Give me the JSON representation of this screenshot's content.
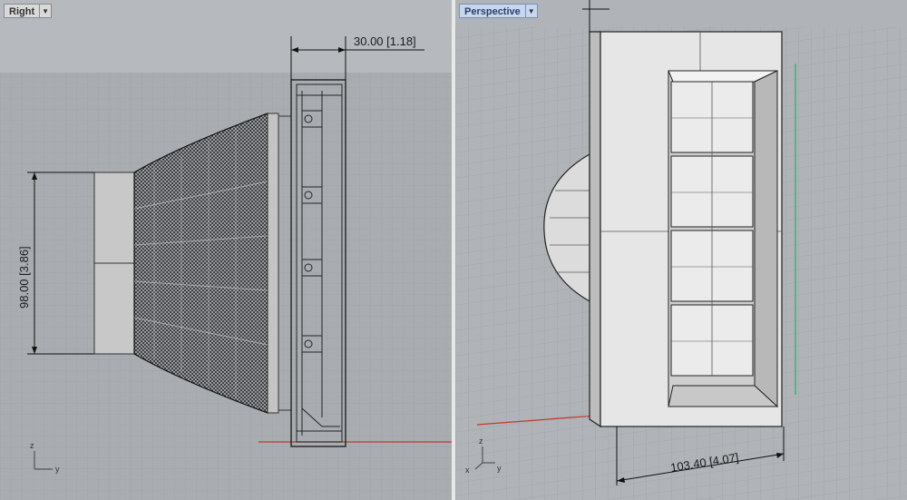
{
  "viewports": {
    "right": {
      "title": "Right",
      "dim_horizontal": "30.00 [1.18]",
      "dim_vertical": "98.00 [3.86]",
      "axis_up": "z",
      "axis_side": "y"
    },
    "perspective": {
      "title": "Perspective",
      "dim_bottom": "103.40 [4.07]",
      "axis_x": "x",
      "axis_z": "z",
      "axis_y": "y"
    }
  },
  "colors": {
    "grid_minor": "#9fa3a7",
    "grid_major": "#8d9195",
    "axis_x": "#c0392b",
    "axis_y": "#27ae60",
    "active_tab": "#c7d7f0"
  },
  "icons": {
    "dropdown": "chevron-down-icon"
  }
}
